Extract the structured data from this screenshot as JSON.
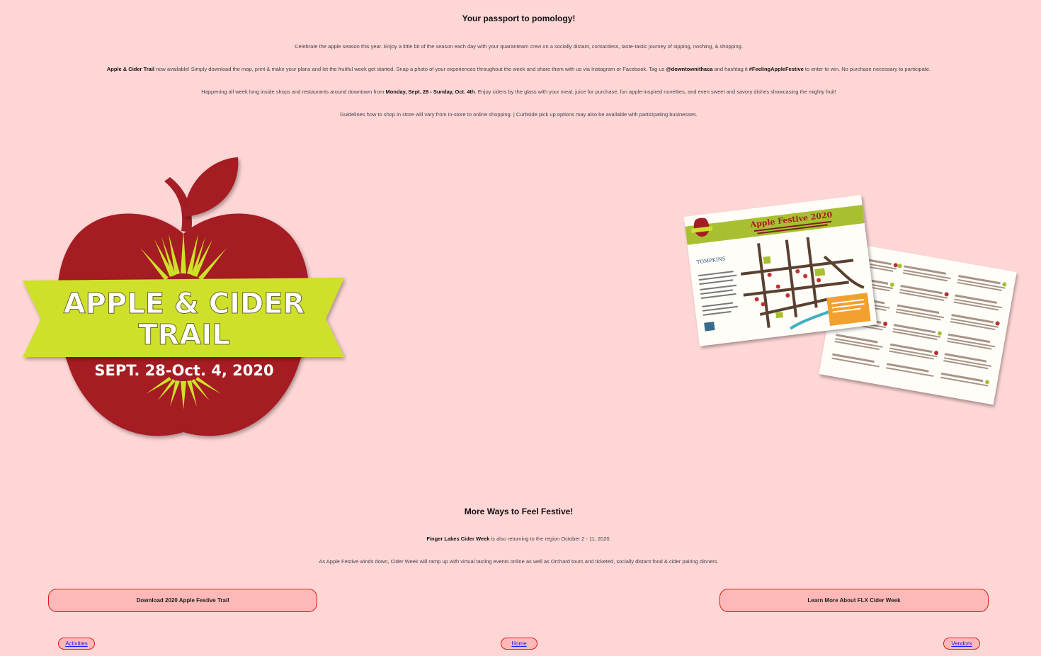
{
  "intro": {
    "title": "Your passport to pomology!",
    "p1": "Celebrate the apple season this year. Enjoy a little bit of the season each day with your quaranteam crew on a socially distant, contactless, taste-tastic journey of sipping, noshing, & shopping.",
    "p2_bold1": "Apple & Cider Trail",
    "p2_text1": " now available! Simply download the map, print & make your plans and let the fruitful week get started. Snap a photo of your experiences throughout the week and share them with us via Instagram or Facebook. Tag us ",
    "p2_bold2": "@downtownithaca",
    "p2_text2": " and hashtag it ",
    "p2_bold3": "#FeelingAppleFestive",
    "p2_text3": " to enter to win. No purchase necessary to participate.",
    "p3_text1": "Happening all week long inside shops and restaurants around downtown from ",
    "p3_bold": "Monday, Sept. 28 - Sunday, Oct. 4th",
    "p3_text2": ". Enjoy ciders by the glass with your meal, juice for purchase, fun apple-inspired novelties, and even sweet and savory dishes showcasing the mighty fruit!",
    "p4": "Guidelines how to shop in store will vary from in-store to online shopping. | Curbside pick up options may also be available with participating businesses."
  },
  "logo": {
    "line1": "APPLE & CIDER",
    "line2": "TRAIL",
    "dates": "SEPT. 28-Oct. 4, 2020",
    "apple_color": "#a51d24",
    "banner_color": "#cfe02a"
  },
  "map_photo": {
    "title": "Apple Festive 2020",
    "sponsor": "TOMPKINS"
  },
  "more": {
    "title": "More Ways to Feel Festive!",
    "p1_bold": "Finger Lakes Cider Week",
    "p1_text": " is also returning to the region October 2 - 11, 2020.",
    "p2": "As Apple Festive winds down, Cider Week will ramp up with virtual tasting events online as well as Orchard tours and ticketed, socially distant food & cider pairing dinners."
  },
  "buttons": {
    "download": "Download 2020 Apple Festive Trail",
    "learn": "Learn More About FLX Cider Week"
  },
  "nav": {
    "activities": "Activities",
    "home": "Home",
    "vendors": "Vendors"
  }
}
